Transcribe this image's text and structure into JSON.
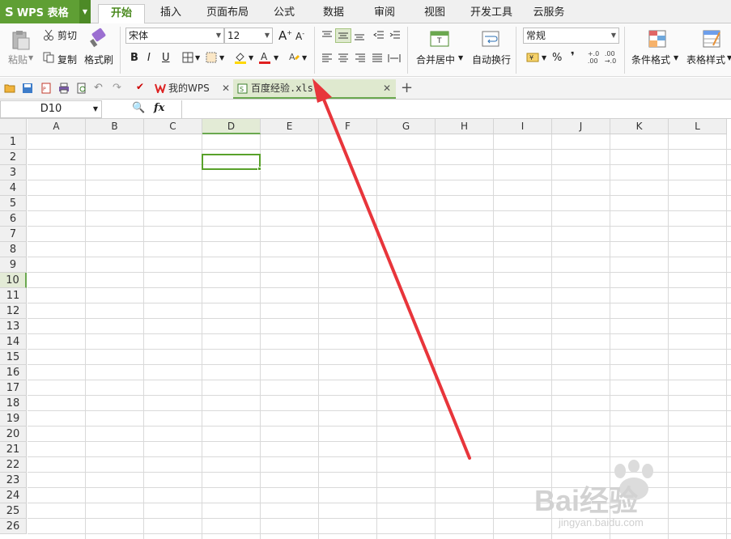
{
  "app": {
    "logo": "S",
    "name": "WPS 表格"
  },
  "menu_tabs": [
    "开始",
    "插入",
    "页面布局",
    "公式",
    "数据",
    "审阅",
    "视图",
    "开发工具",
    "云服务"
  ],
  "ribbon": {
    "paste": "粘贴",
    "cut": "剪切",
    "copy": "复制",
    "format_painter": "格式刷",
    "font_name": "宋体",
    "font_size": "12",
    "bold": "B",
    "italic": "I",
    "underline": "U",
    "merge_center": "合并居中",
    "auto_wrap": "自动换行",
    "number_format": "常规",
    "percent": "%",
    "comma": "❜",
    "cond_format": "条件格式",
    "table_style": "表格样式"
  },
  "doc_tabs": [
    {
      "label": "我的WPS"
    },
    {
      "label": "百度经验.xls"
    }
  ],
  "formula": {
    "cell_ref": "D10",
    "fx": "fx",
    "content": ""
  },
  "columns": [
    "A",
    "B",
    "C",
    "D",
    "E",
    "F",
    "G",
    "H",
    "I",
    "J",
    "K",
    "L"
  ],
  "rows": [
    "1",
    "2",
    "3",
    "4",
    "5",
    "6",
    "7",
    "8",
    "9",
    "10",
    "11",
    "12",
    "13",
    "14",
    "15",
    "16",
    "17",
    "18",
    "19",
    "20",
    "21",
    "22",
    "23",
    "24",
    "25",
    "26"
  ],
  "selected_cell": {
    "column": "D",
    "row": "10"
  },
  "watermark": {
    "brand": "Bai经验",
    "url": "jingyan.baidu.com"
  },
  "colors": {
    "brand_green": "#5f9f34",
    "selection": "#58a12a",
    "arrow": "#e8353b"
  }
}
